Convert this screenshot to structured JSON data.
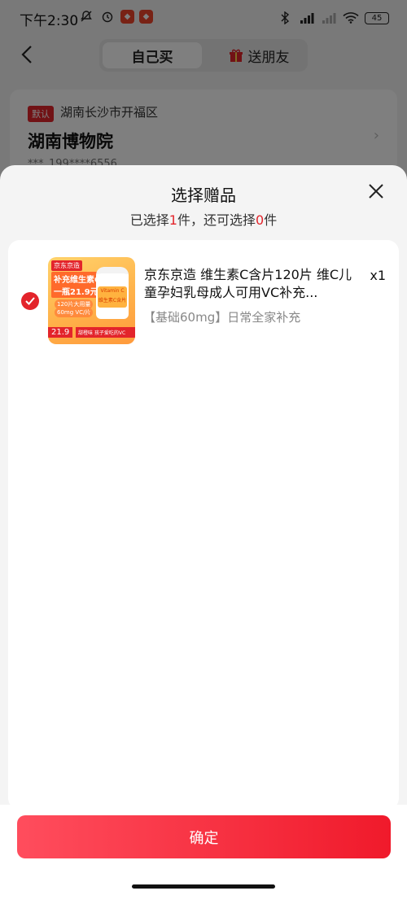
{
  "status_bar": {
    "time": "下午2:30",
    "battery": "45"
  },
  "nav": {
    "tab_self": "自己买",
    "tab_gift": "送朋友"
  },
  "address": {
    "default_tag": "默认",
    "region": "湖南长沙市开福区",
    "name": "湖南博物院",
    "phone": "***_199****6556"
  },
  "sheet": {
    "title": "选择赠品",
    "sub_prefix": "已选择",
    "selected_count": "1",
    "sub_middle": "件，还可选择",
    "remaining_count": "0",
    "sub_suffix": "件"
  },
  "product": {
    "title": "京东京造 维生素C含片120片 维C儿童孕妇乳母成人可用VC补充...",
    "spec": "【基础60mg】日常全家补充",
    "quantity": "x1",
    "selected": true,
    "image_text": {
      "brand": "京东京造",
      "line1": "补充维生素C",
      "line2": "一瓶21.9元",
      "line3": "120片大用量",
      "line4": "60mg VC/片",
      "bottle_label": "Vitamin C 维生素C含片",
      "price": "21.9",
      "strip": "甜橙味 孩子爱吃的VC"
    }
  },
  "footer": {
    "confirm_label": "确定"
  },
  "colors": {
    "accent_red": "#e3242b",
    "button_gradient_start": "#ff4d5d",
    "button_gradient_end": "#f01a2b"
  }
}
